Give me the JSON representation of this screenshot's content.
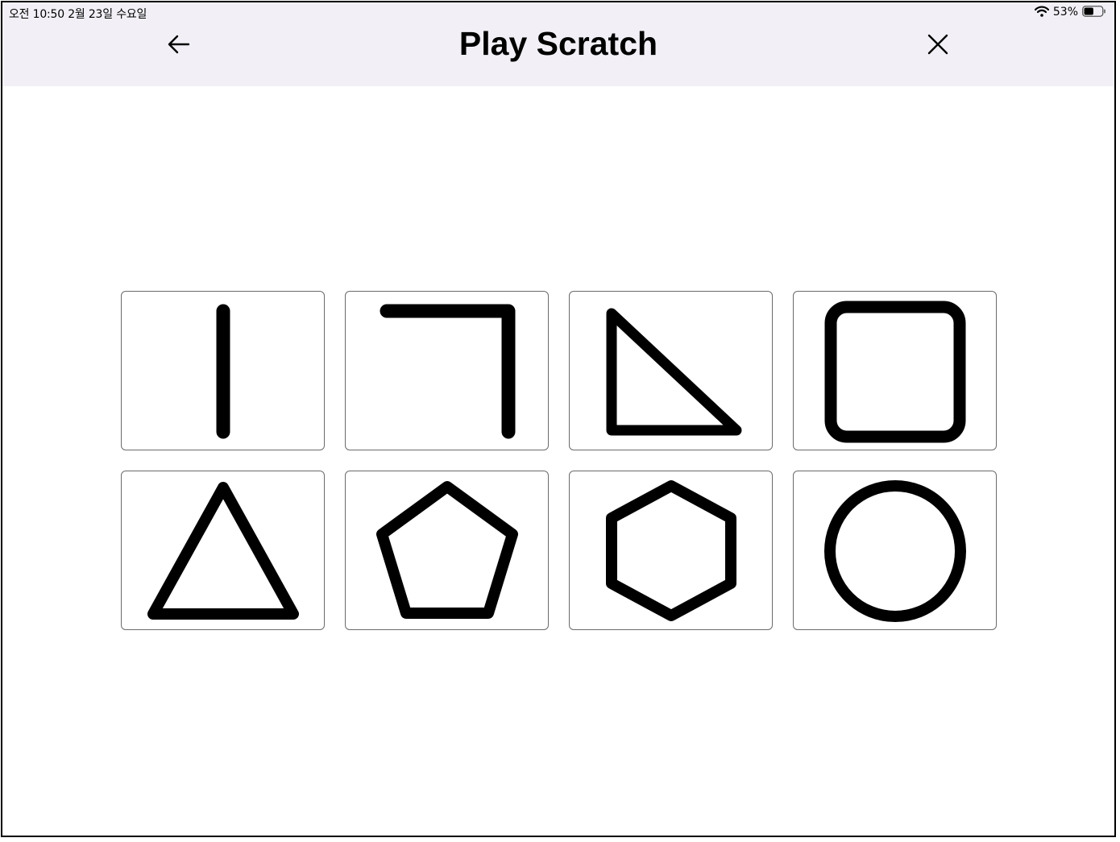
{
  "status_bar": {
    "time_date": "오전 10:50   2월 23일 수요일",
    "battery_percent": "53%",
    "battery_level": 0.53,
    "wifi_icon": "wifi-icon",
    "battery_icon": "battery-icon"
  },
  "nav": {
    "title": "Play Scratch",
    "back_icon": "arrow-left-icon",
    "close_icon": "close-icon"
  },
  "shapes": [
    {
      "id": "line",
      "icon": "line-shape-icon"
    },
    {
      "id": "angle",
      "icon": "angle-shape-icon"
    },
    {
      "id": "right-triangle",
      "icon": "right-triangle-shape-icon"
    },
    {
      "id": "square",
      "icon": "square-shape-icon"
    },
    {
      "id": "triangle",
      "icon": "triangle-shape-icon"
    },
    {
      "id": "pentagon",
      "icon": "pentagon-shape-icon"
    },
    {
      "id": "hexagon",
      "icon": "hexagon-shape-icon"
    },
    {
      "id": "circle",
      "icon": "circle-shape-icon"
    }
  ],
  "colors": {
    "header_bg": "#f2f0f6",
    "card_border": "#6b6b6b",
    "shape_stroke": "#000000"
  }
}
